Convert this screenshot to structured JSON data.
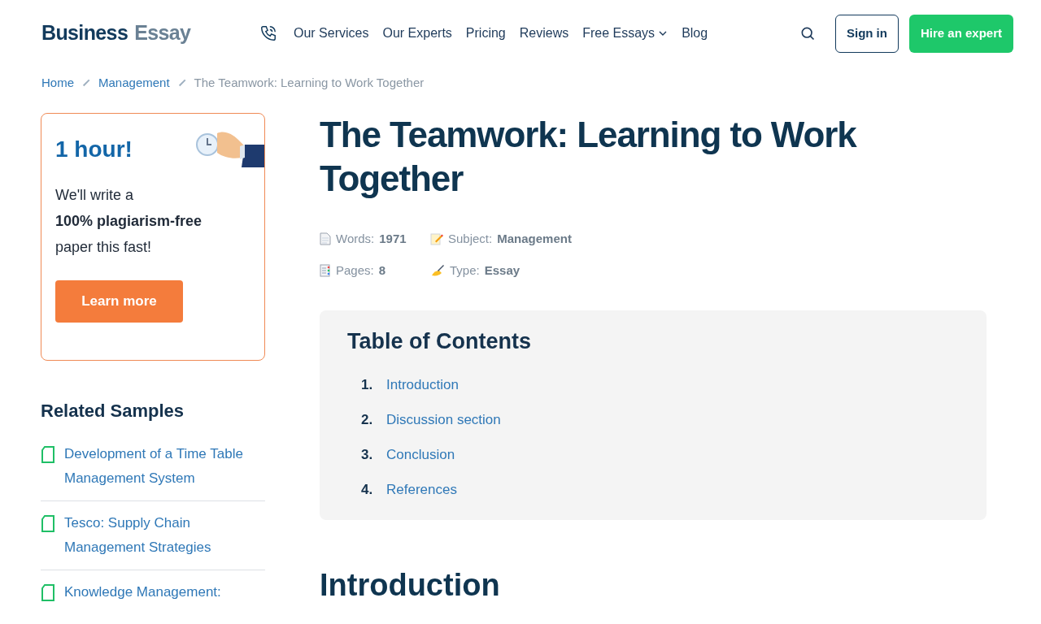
{
  "header": {
    "logo": {
      "primary": "Business",
      "secondary": "Essay"
    },
    "nav": [
      {
        "label": "Our Services",
        "dropdown": false
      },
      {
        "label": "Our Experts",
        "dropdown": false
      },
      {
        "label": "Pricing",
        "dropdown": false
      },
      {
        "label": "Reviews",
        "dropdown": false
      },
      {
        "label": "Free Essays",
        "dropdown": true
      },
      {
        "label": "Blog",
        "dropdown": false
      }
    ],
    "sign_in": "Sign in",
    "hire": "Hire an expert"
  },
  "breadcrumbs": [
    {
      "label": "Home",
      "link": true
    },
    {
      "label": "Management",
      "link": true
    },
    {
      "label": "The Teamwork: Learning to Work Together",
      "link": false
    }
  ],
  "promo": {
    "headline": "1 hour!",
    "text": "We'll write a",
    "bold": "100% plagiarism-free",
    "text2": "paper this fast!",
    "button": "Learn more"
  },
  "related": {
    "title": "Related Samples",
    "items": [
      "Development of a Time Table Management System",
      "Tesco: Supply Chain Management Strategies",
      "Knowledge Management:"
    ]
  },
  "article": {
    "title": "The Teamwork: Learning to Work Together",
    "meta": [
      {
        "kind": "words",
        "label": "Words:",
        "value": "1971"
      },
      {
        "kind": "subject",
        "label": "Subject:",
        "value": "Management"
      },
      {
        "kind": "pages",
        "label": "Pages:",
        "value": "8"
      },
      {
        "kind": "type",
        "label": "Type:",
        "value": "Essay"
      }
    ],
    "toc": {
      "title": "Table of Contents",
      "items": [
        {
          "number": "1.",
          "label": "Introduction"
        },
        {
          "number": "2.",
          "label": "Discussion section"
        },
        {
          "number": "3.",
          "label": "Conclusion"
        },
        {
          "number": "4.",
          "label": "References"
        }
      ]
    },
    "section_heading": "Introduction"
  }
}
